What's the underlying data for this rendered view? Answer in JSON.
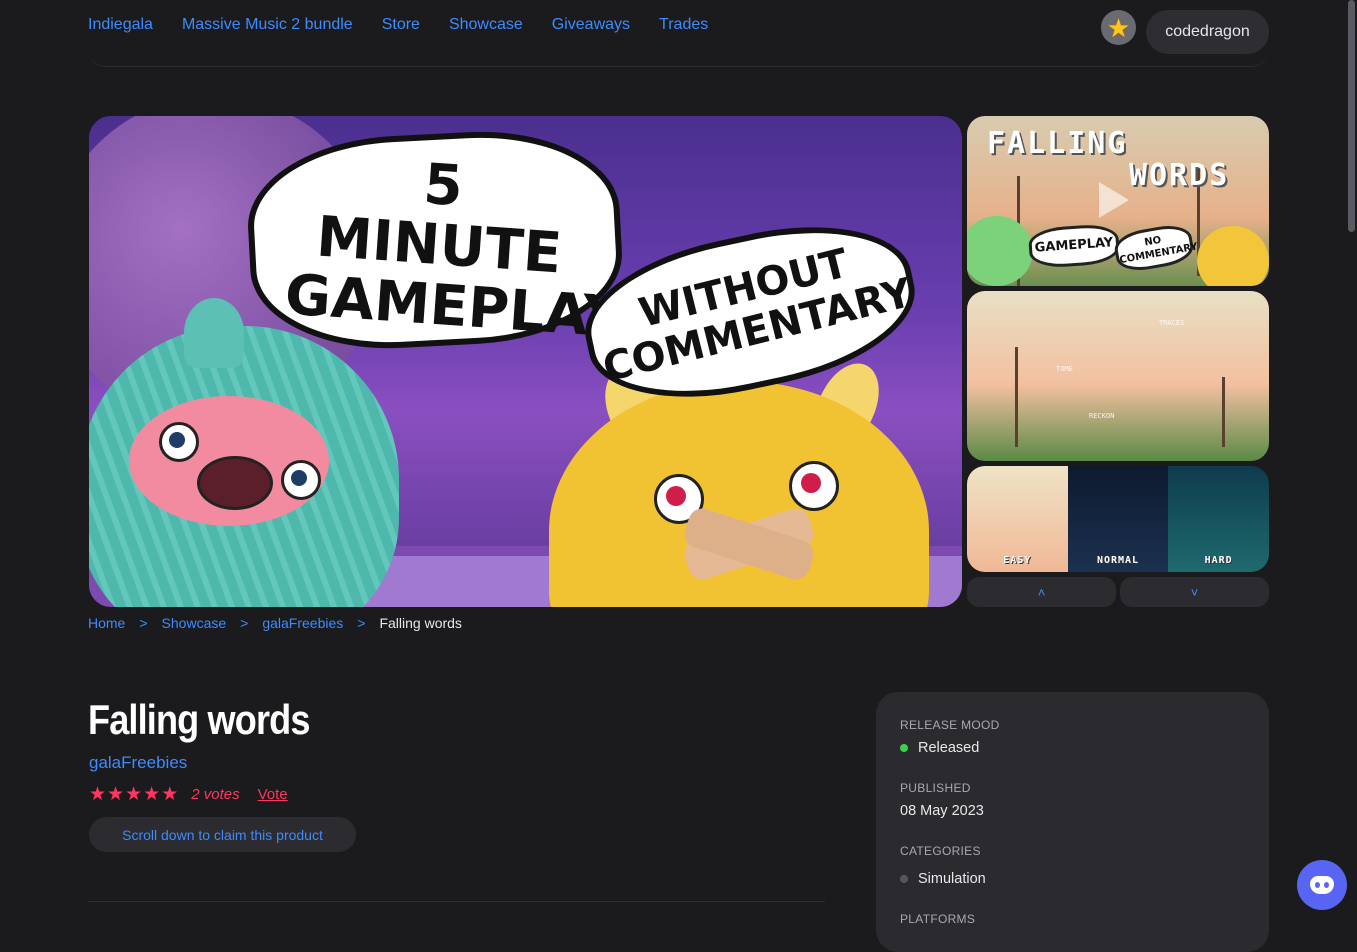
{
  "nav": {
    "links": [
      "Indiegala",
      "Massive Music 2 bundle",
      "Store",
      "Showcase",
      "Giveaways",
      "Trades"
    ],
    "username": "codedragon",
    "avatar_icon": "star-icon"
  },
  "hero": {
    "bubble_main_text": "5 MINUTE GAMEPLAY",
    "bubble_secondary_text": "WITHOUT COMMENTARY"
  },
  "thumbnails": {
    "thumb1": {
      "title_top": "FALLING",
      "title_bottom": "WORDS",
      "bubble_left": "GAMEPLAY",
      "bubble_right": "NO COMMENTARY"
    },
    "thumb2": {
      "word1": "TRACES",
      "word2": "TOME",
      "word3": "RECKON"
    },
    "thumb3": {
      "modes": [
        "EASY",
        "NORMAL",
        "HARD"
      ]
    }
  },
  "gallery_controls": {
    "up_icon": "chevron-up-icon",
    "down_icon": "chevron-down-icon"
  },
  "breadcrumb": {
    "items": [
      "Home",
      "Showcase",
      "galaFreebies"
    ],
    "separator": ">",
    "current": "Falling words"
  },
  "product": {
    "title": "Falling words",
    "publisher": "galaFreebies",
    "rating_stars": 5,
    "votes": "2 votes",
    "vote_label": "Vote",
    "claim_label": "Scroll down to claim this product"
  },
  "info": {
    "release_mood_label": "RELEASE MOOD",
    "release_mood_value": "Released",
    "release_mood_color": "#3ccf4e",
    "published_label": "PUBLISHED",
    "published_value": "08 May 2023",
    "categories_label": "CATEGORIES",
    "categories": [
      "Simulation"
    ],
    "platforms_label": "PLATFORMS"
  },
  "colors": {
    "accent": "#3d8bff",
    "rating": "#ff3660",
    "background": "#1b1b1e",
    "panel": "#2a2a2f"
  }
}
